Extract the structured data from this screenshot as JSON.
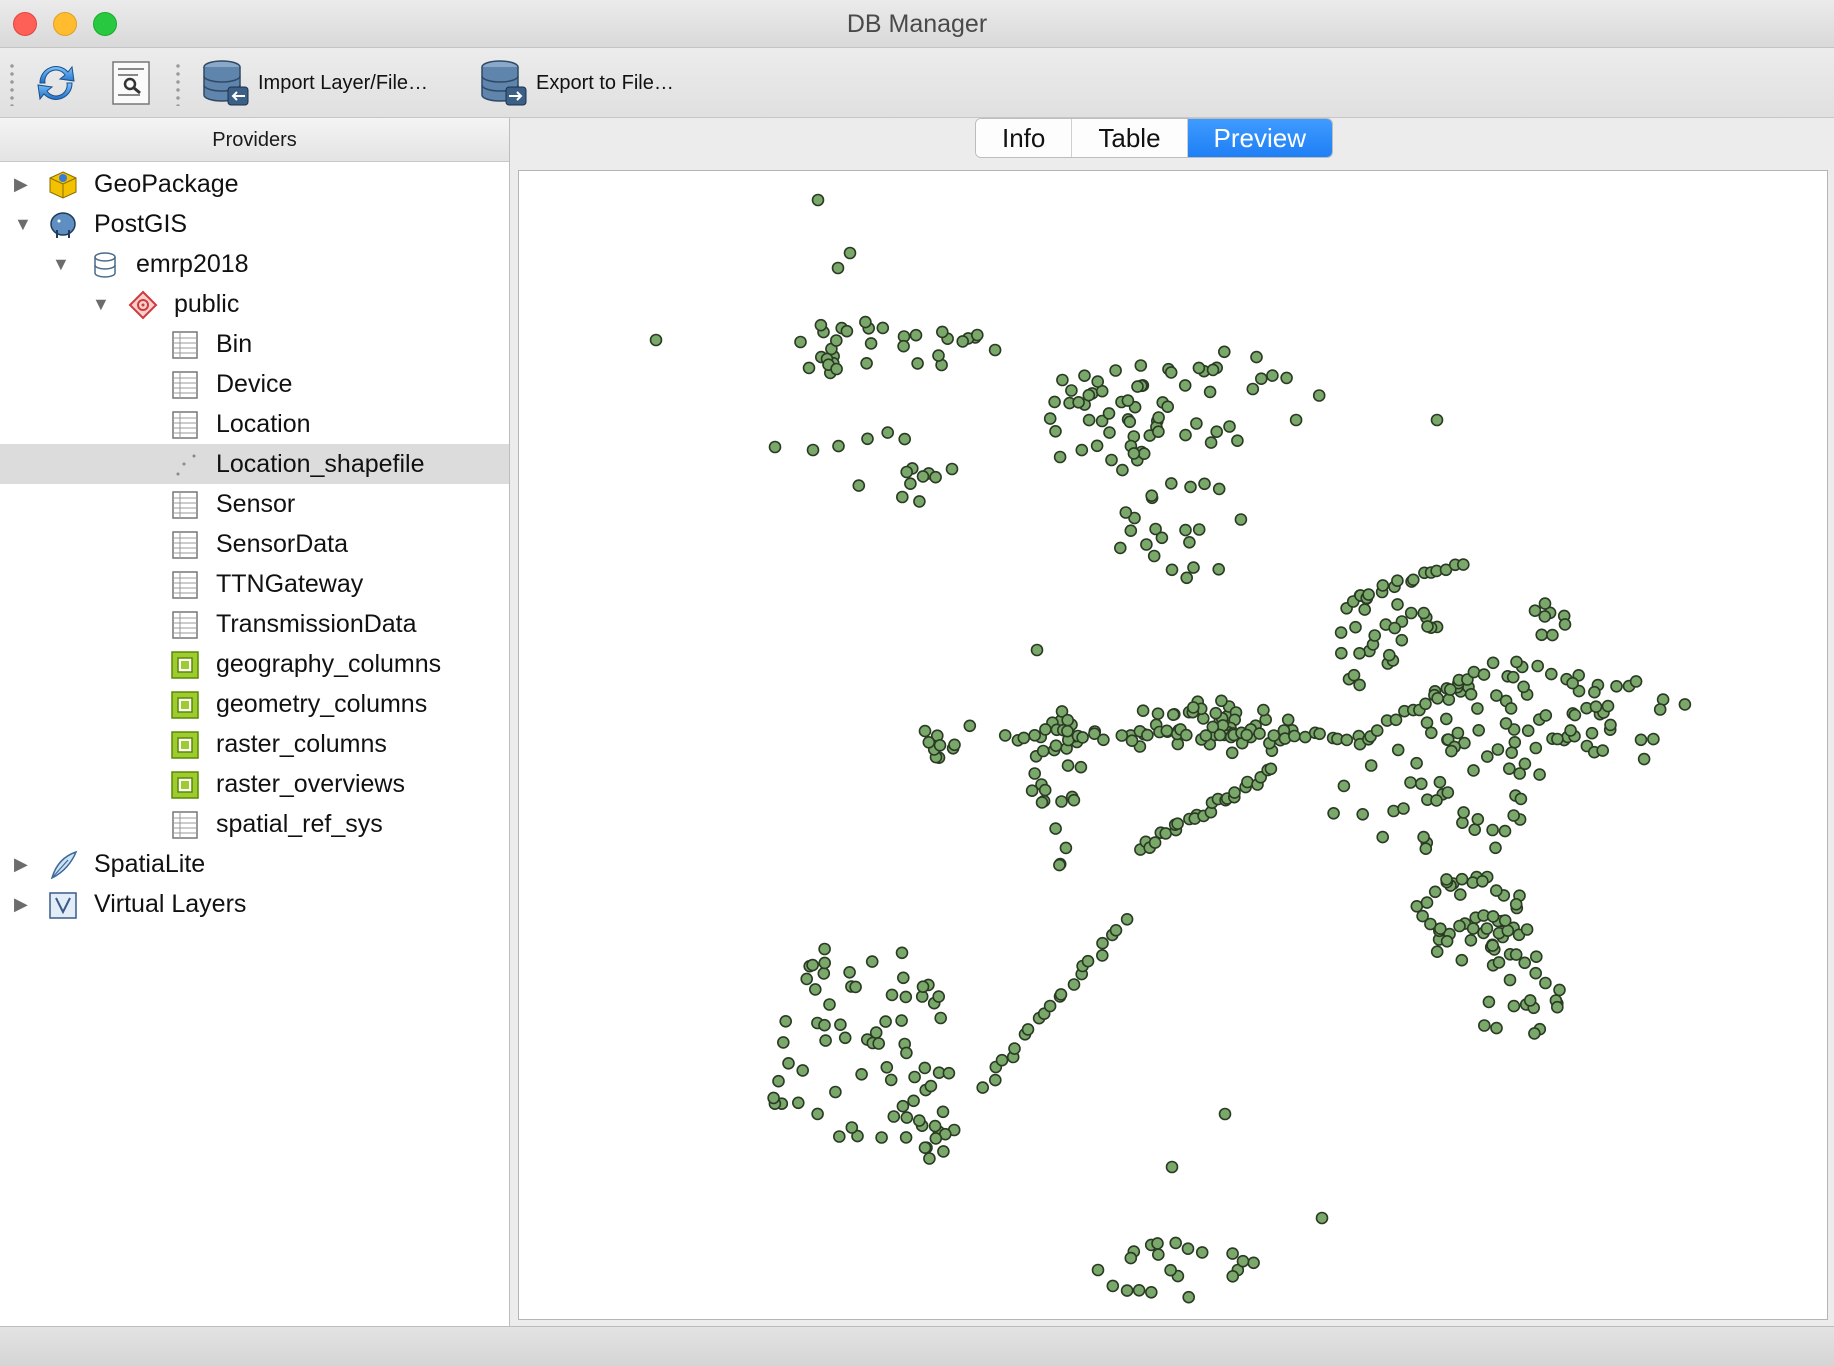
{
  "window": {
    "title": "DB Manager"
  },
  "toolbar": {
    "refresh_icon": "refresh-icon",
    "sql_window_icon": "sql-window-icon",
    "import_label": "Import Layer/File…",
    "export_label": "Export to File…"
  },
  "providers": {
    "header": "Providers",
    "items": [
      {
        "label": "GeoPackage",
        "level": 0,
        "arrow": "▶",
        "icon": "geopackage-icon"
      },
      {
        "label": "PostGIS",
        "level": 0,
        "arrow": "▼",
        "icon": "postgis-icon"
      },
      {
        "label": "emrp2018",
        "level": 1,
        "arrow": "▼",
        "icon": "database-icon"
      },
      {
        "label": "public",
        "level": 2,
        "arrow": "▼",
        "icon": "schema-icon"
      },
      {
        "label": "Bin",
        "level": 3,
        "arrow": "",
        "icon": "table-icon"
      },
      {
        "label": "Device",
        "level": 3,
        "arrow": "",
        "icon": "table-icon"
      },
      {
        "label": "Location",
        "level": 3,
        "arrow": "",
        "icon": "table-icon"
      },
      {
        "label": "Location_shapefile",
        "level": 3,
        "arrow": "",
        "icon": "point-layer-icon",
        "selected": true
      },
      {
        "label": "Sensor",
        "level": 3,
        "arrow": "",
        "icon": "table-icon"
      },
      {
        "label": "SensorData",
        "level": 3,
        "arrow": "",
        "icon": "table-icon"
      },
      {
        "label": "TTNGateway",
        "level": 3,
        "arrow": "",
        "icon": "table-icon"
      },
      {
        "label": "TransmissionData",
        "level": 3,
        "arrow": "",
        "icon": "table-icon"
      },
      {
        "label": "geography_columns",
        "level": 3,
        "arrow": "",
        "icon": "view-icon"
      },
      {
        "label": "geometry_columns",
        "level": 3,
        "arrow": "",
        "icon": "view-icon"
      },
      {
        "label": "raster_columns",
        "level": 3,
        "arrow": "",
        "icon": "view-icon"
      },
      {
        "label": "raster_overviews",
        "level": 3,
        "arrow": "",
        "icon": "view-icon"
      },
      {
        "label": "spatial_ref_sys",
        "level": 3,
        "arrow": "",
        "icon": "table-icon"
      },
      {
        "label": "SpatiaLite",
        "level": 0,
        "arrow": "▶",
        "icon": "spatialite-icon"
      },
      {
        "label": "Virtual Layers",
        "level": 0,
        "arrow": "▶",
        "icon": "virtual-layers-icon"
      }
    ]
  },
  "tabs": [
    {
      "label": "Info",
      "active": false
    },
    {
      "label": "Table",
      "active": false
    },
    {
      "label": "Preview",
      "active": true
    }
  ],
  "preview": {
    "point_fill": "#7aa86a",
    "point_stroke": "#2a3a24",
    "selected_layer": "Location_shapefile"
  }
}
